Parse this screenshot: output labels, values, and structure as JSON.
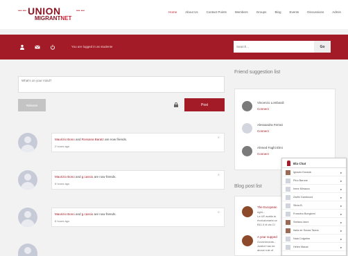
{
  "brand": {
    "title": "UNION",
    "sub_a": "MIGRANT",
    "sub_b": "NET",
    "dots": "••• •••",
    "color": "#a31b26"
  },
  "nav": [
    "Home",
    "About Us",
    "Contact Points",
    "Members",
    "Groups",
    "Blog",
    "Events",
    "Discussions",
    "Admin"
  ],
  "toolbar": {
    "icons": [
      "user-icon",
      "mail-icon",
      "power-icon"
    ],
    "status": "You are logged in as studente",
    "search_placeholder": "Search...",
    "go_label": "Go"
  },
  "composer": {
    "placeholder": "What's on your mind?",
    "release_label": "Release",
    "post_label": "Post"
  },
  "feed": [
    {
      "actor_a": "Maurizio Bono",
      "and": " and ",
      "actor_b": "Rossana Baratz",
      "rest": " are now friends.",
      "time": "2 hours ago",
      "close": "✕"
    },
    {
      "actor_a": "Maurizio Bono",
      "and": " and ",
      "actor_b": "g.cassio",
      "rest": " are now friends.",
      "time": "6 hours ago",
      "close": "✕"
    },
    {
      "actor_a": "Maurizio Bono",
      "and": " and ",
      "actor_b": "g.cassio",
      "rest": " are now friends.",
      "time": "6 hours ago",
      "close": "✕"
    }
  ],
  "friends": {
    "title": "Friend suggestion list",
    "items": [
      {
        "name": "Vincenzo Lombardi",
        "action": "Connect"
      },
      {
        "name": "Alessandra Ferrari",
        "action": "Connect"
      },
      {
        "name": "Ahmed Faghi Elmi",
        "action": "Connect"
      }
    ]
  },
  "blog": {
    "title": "Blog post list",
    "items": [
      {
        "title": "The European",
        "lines": [
          "right...",
          "La UE avalla la",
          "rivoluzionaria ce",
          "B11.0 di via Ci"
        ]
      },
      {
        "title": "A year supped",
        "lines": [
          "Governments...",
          "Justice has be",
          "above rule of"
        ]
      }
    ]
  },
  "chat": {
    "title": "Bla Chat",
    "users": [
      "Ignazio Dorada",
      "Pino Barone",
      "Irene Minasco",
      "Zarith Gambouni",
      "Silvia B.",
      "Franzino Bongiorni",
      "Stefano Ianni",
      "Ilaria de Sousa Tanna",
      "Naia Colgebre",
      "Helen Manat"
    ],
    "dot": "●"
  }
}
